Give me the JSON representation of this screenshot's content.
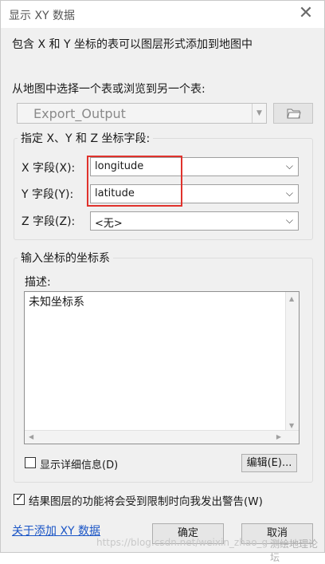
{
  "window": {
    "title": "显示 XY 数据",
    "close_glyph": "✕"
  },
  "description": "包含 X 和 Y 坐标的表可以图层形式添加到地图中",
  "table_select": {
    "label": "从地图中选择一个表或浏览到另一个表:",
    "value": "Export_Output"
  },
  "xyz_group": {
    "legend": "指定 X、Y 和 Z 坐标字段:",
    "x": {
      "label": "X 字段(X):",
      "value": "longitude"
    },
    "y": {
      "label": "Y 字段(Y):",
      "value": "latitude"
    },
    "z": {
      "label": "Z 字段(Z):",
      "value": "<无>"
    }
  },
  "coord_group": {
    "legend": "输入坐标的坐标系",
    "desc_label": "描述:",
    "desc_value": "未知坐标系",
    "show_details_label": "显示详细信息(D)",
    "show_details_checked": false,
    "edit_button": "编辑(E)..."
  },
  "warn_checkbox": {
    "label": "结果图层的功能将会受到限制时向我发出警告(W)",
    "checked": true
  },
  "about_link": "关于添加 XY 数据",
  "buttons": {
    "ok": "确定",
    "cancel": "取消"
  },
  "watermarks": {
    "url": "https://blog.csdn.net/weixin_zhao_g",
    "brand": "测绘地理论坛"
  },
  "colors": {
    "highlight": "#e0322c",
    "link": "#1a55c6"
  }
}
